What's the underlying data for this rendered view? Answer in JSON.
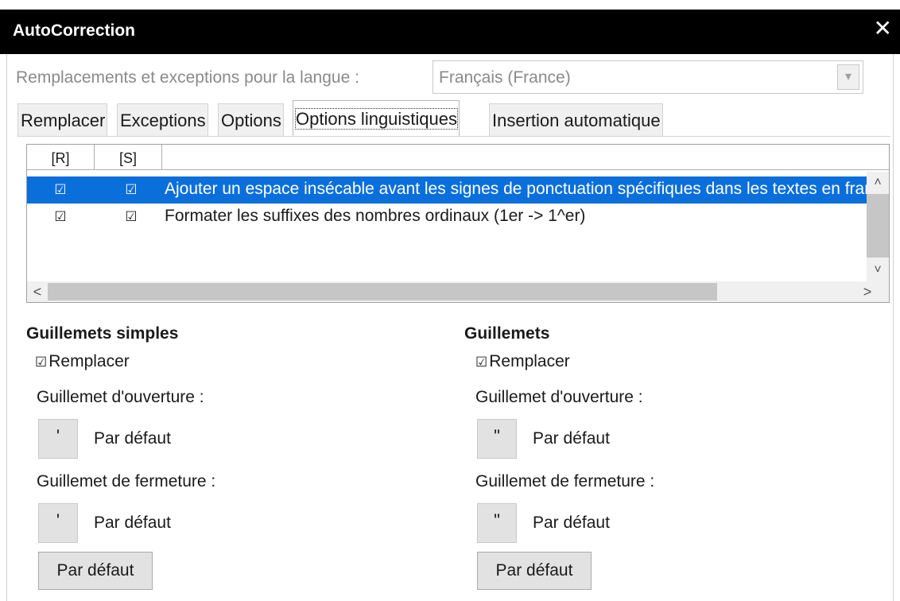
{
  "window": {
    "title": "AutoCorrection",
    "close_glyph": "✕"
  },
  "language": {
    "label": "Remplacements et exceptions pour la langue :",
    "value": "Français (France)",
    "dropdown_glyph": "▾"
  },
  "tabs": [
    {
      "label": "Remplacer"
    },
    {
      "label": "Exceptions"
    },
    {
      "label": "Options"
    },
    {
      "label": "Options linguistiques"
    },
    {
      "label": "Insertion automatique"
    }
  ],
  "grid": {
    "headers": [
      "[R]",
      "[S]"
    ],
    "rows": [
      {
        "r": "☑",
        "s": "☑",
        "text": "Ajouter un espace insécable avant les signes de ponctuation spécifiques dans les textes en français"
      },
      {
        "r": "☑",
        "s": "☑",
        "text": "Formater les suffixes des nombres ordinaux (1er -> 1^er)"
      }
    ],
    "scroll_up": "˄",
    "scroll_down": "˅",
    "scroll_left": "<",
    "scroll_right": ">"
  },
  "single_quotes": {
    "title": "Guillemets simples",
    "check_glyph": "☑",
    "replace_label": "Remplacer",
    "opening_label": "Guillemet d'ouverture :",
    "opening_char": "'",
    "opening_desc": "Par défaut",
    "closing_label": "Guillemet de fermeture :",
    "closing_char": "'",
    "closing_desc": "Par défaut",
    "default_button": "Par défaut"
  },
  "double_quotes": {
    "title": "Guillemets",
    "check_glyph": "☑",
    "replace_label": "Remplacer",
    "opening_label": "Guillemet d'ouverture :",
    "opening_char": "\"",
    "opening_desc": "Par défaut",
    "closing_label": "Guillemet de fermeture :",
    "closing_char": "\"",
    "closing_desc": "Par défaut",
    "default_button": "Par défaut"
  },
  "colors": {
    "selection": "#0a6fdb",
    "titlebar": "#000000"
  }
}
